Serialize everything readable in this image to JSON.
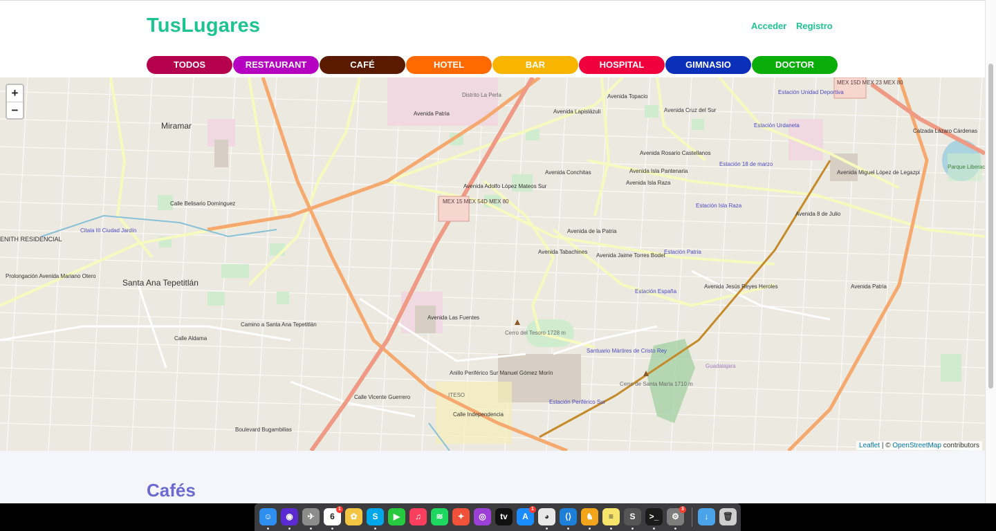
{
  "brand": "TusLugares",
  "nav": {
    "login": "Acceder",
    "register": "Registro"
  },
  "categories": [
    {
      "label": "TODOS",
      "color": "#b5004e"
    },
    {
      "label": "RESTAURANT",
      "color": "#b500c2"
    },
    {
      "label": "CAFÉ",
      "color": "#5a1a00"
    },
    {
      "label": "HOTEL",
      "color": "#ff6a00"
    },
    {
      "label": "BAR",
      "color": "#f7b500"
    },
    {
      "label": "HOSPITAL",
      "color": "#f0003c"
    },
    {
      "label": "GIMNASIO",
      "color": "#0b2fb8"
    },
    {
      "label": "DOCTOR",
      "color": "#0aae0a"
    }
  ],
  "map": {
    "zoom_in": "+",
    "zoom_out": "−",
    "attribution": {
      "leaflet": "Leaflet",
      "separator": " | © ",
      "osm": "OpenStreetMap",
      "suffix": " contributors"
    },
    "labels": {
      "miramar": "Miramar",
      "santa_ana": "Santa Ana Tepetitlán",
      "zenith": "ENITH RESIDENCIAL",
      "citala": "Citala III Ciudad Jardín",
      "distrito": "Distrito La Perla",
      "mex_center": "MEX 15 MEX 54D MEX 80",
      "mex_corner": "MEX 15D MEX 23 MEX 80",
      "cerro_tesoro": "Cerro del Tesoro 1728 m",
      "cerro_santa_maria": "Cerro de Santa María 1710 m",
      "santuario": "Santuario Mártires de Cristo Rey",
      "iteso": "ITESO",
      "parque": "Parque Liberación",
      "est_unidad": "Estación Unidad Deportiva",
      "est_urdaneta": "Estación Urdaneta",
      "est_18marzo": "Estación 18 de marzo",
      "est_isla_raza": "Estación Isla Raza",
      "est_patria": "Estación Patria",
      "est_espana": "Estación España",
      "est_periferico": "Estación Periférico Sur",
      "av_patria": "Avenida de la Patria",
      "av_isla_raza": "Avenida Isla Raza",
      "av_lopez_mateos": "Avenida Adolfo López Mateos Sur",
      "av_mariano_otero": "Prolongación Avenida Mariano Otero",
      "periferico": "Anillo Periférico Sur Manuel Gómez Morín",
      "belisario": "Calle Belisario Domínguez",
      "camino_santa_ana": "Camino a Santa Ana Tepetitlán",
      "lopez_legazpi": "Avenida Miguel López de Legazpi",
      "calzada": "Calzada Lázaro Cárdenas",
      "av_conchitas": "Avenida Conchitas",
      "av_rosario": "Avenida Rosario Castellanos",
      "av_isla_pantenaria": "Avenida Isla Pantenaria",
      "av_cruz_sur": "Avenida Cruz del Sur",
      "jesus_reyes": "Avenida Jesús Reyes Heroles",
      "jaime_torres": "Avenida Jaime Torres Bodet",
      "av_tabachines": "Avenida Tabachines",
      "av_patria_e": "Avenida Patria",
      "guadalajara": "Guadalajara",
      "calle_independencia": "Calle Independencia",
      "calle_vicente": "Calle Vicente Guerrero",
      "boulevard": "Boulevard Bugambilias",
      "av_lapislazuli": "Avenida Lapislázuli",
      "av_topacio": "Avenida Topacio",
      "av_las_fuentes": "Avenida Las Fuentes",
      "av_patria_sur": "Avenida Patria",
      "calle_aldama": "Calle Aldama",
      "av_colomos": "Avenida 8 de Julio"
    }
  },
  "section_title": "Cafés",
  "dock": {
    "calendar_day": "6",
    "calendar_badge": "1",
    "appstore_badge": "1",
    "settings_badge": "3",
    "apps": [
      {
        "name": "finder",
        "color": "#2f8ff0",
        "glyph": "☺"
      },
      {
        "name": "siri",
        "color": "#5b2bd1",
        "glyph": "◉"
      },
      {
        "name": "launchpad",
        "color": "#8c8c8c",
        "glyph": "✈"
      },
      {
        "name": "calendar",
        "color": "#ffffff",
        "glyph": ""
      },
      {
        "name": "photos",
        "color": "#f4c542",
        "glyph": "✿"
      },
      {
        "name": "skype",
        "color": "#00a7e8",
        "glyph": "S"
      },
      {
        "name": "facetime",
        "color": "#27c93f",
        "glyph": "▶"
      },
      {
        "name": "music",
        "color": "#fa3e5e",
        "glyph": "♫"
      },
      {
        "name": "spotify",
        "color": "#1ed760",
        "glyph": "≋"
      },
      {
        "name": "swift",
        "color": "#f05138",
        "glyph": "✦"
      },
      {
        "name": "podcasts",
        "color": "#9b3fd6",
        "glyph": "◎"
      },
      {
        "name": "apple-tv",
        "color": "#111111",
        "glyph": "tv"
      },
      {
        "name": "app-store",
        "color": "#1a8cff",
        "glyph": "A"
      },
      {
        "name": "chrome",
        "color": "#e8e8e8",
        "glyph": "◕"
      },
      {
        "name": "vscode",
        "color": "#1e7fd8",
        "glyph": "⟨⟩"
      },
      {
        "name": "postgres",
        "color": "#f2a51a",
        "glyph": "♞"
      },
      {
        "name": "notes",
        "color": "#f7e46b",
        "glyph": "≡"
      },
      {
        "name": "sublime",
        "color": "#555555",
        "glyph": "S"
      },
      {
        "name": "terminal",
        "color": "#1b1b1b",
        "glyph": ">_"
      },
      {
        "name": "system-prefs",
        "color": "#7d7d7d",
        "glyph": "⚙"
      },
      {
        "name": "downloads",
        "color": "#4ba3ea",
        "glyph": "↓"
      },
      {
        "name": "trash",
        "color": "#cfcfcf",
        "glyph": "🗑"
      }
    ]
  }
}
